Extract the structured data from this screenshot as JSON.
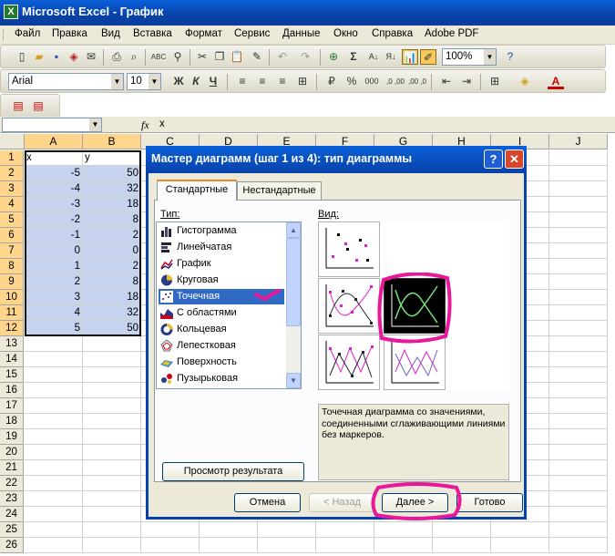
{
  "window": {
    "title": "Microsoft Excel - График"
  },
  "menu": [
    "Файл",
    "Правка",
    "Вид",
    "Вставка",
    "Формат",
    "Сервис",
    "Данные",
    "Окно",
    "Справка",
    "Adobe PDF"
  ],
  "toolbar": {
    "zoom": "100%",
    "font_name": "Arial",
    "font_size": "10",
    "bold": "Ж",
    "italic": "К",
    "underline": "Ч",
    "percent": "%",
    "thousands": "000",
    "dec_inc": ",0 ,00",
    "dec_dec": ",00 ,0"
  },
  "formula_bar": {
    "fx": "fx",
    "value": "x"
  },
  "columns": [
    "A",
    "B",
    "C",
    "D",
    "E",
    "F",
    "G",
    "H",
    "I",
    "J"
  ],
  "rows": [
    "1",
    "2",
    "3",
    "4",
    "5",
    "6",
    "7",
    "8",
    "9",
    "10",
    "11",
    "12",
    "13",
    "14",
    "15",
    "16",
    "17",
    "18",
    "19",
    "20",
    "21",
    "22",
    "23",
    "24",
    "25",
    "26"
  ],
  "cells": {
    "A": [
      "x",
      "-5",
      "-4",
      "-3",
      "-2",
      "-1",
      "0",
      "1",
      "2",
      "3",
      "4",
      "5"
    ],
    "B": [
      "y",
      "50",
      "32",
      "18",
      "8",
      "2",
      "0",
      "2",
      "8",
      "18",
      "32",
      "50"
    ]
  },
  "dialog": {
    "title": "Мастер диаграмм (шаг 1 из 4): тип диаграммы",
    "help": "?",
    "close": "✕",
    "tabs": [
      "Стандартные",
      "Нестандартные"
    ],
    "type_label": "Тип:",
    "view_label": "Вид:",
    "types": [
      "Гистограмма",
      "Линейчатая",
      "График",
      "Круговая",
      "Точечная",
      "С областями",
      "Кольцевая",
      "Лепестковая",
      "Поверхность",
      "Пузырьковая"
    ],
    "selected_type": "Точечная",
    "description": "Точечная диаграмма со значениями, соединенными сглаживающими линиями без маркеров.",
    "preview_button": "Просмотр результата",
    "buttons": {
      "cancel": "Отмена",
      "back": "< Назад",
      "next": "Далее >",
      "finish": "Готово"
    }
  },
  "colors": {
    "title_bar": "#0a5fd8",
    "selection": "#316ac5",
    "highlight_range": "#c6d3ef",
    "annotation": "#e8189a"
  }
}
